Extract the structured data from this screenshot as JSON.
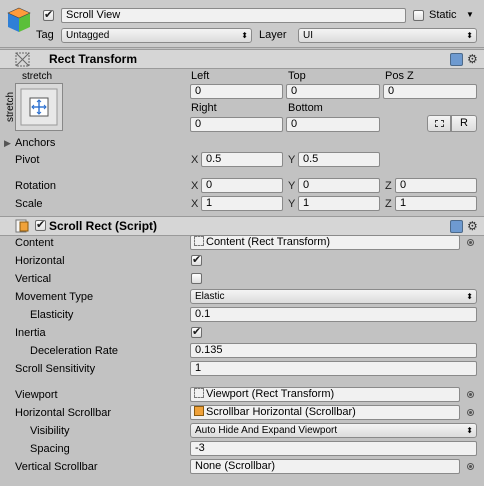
{
  "gameobject": {
    "name": "Scroll View",
    "static_label": "Static",
    "active": true,
    "static": false,
    "tag_label": "Tag",
    "tag_value": "Untagged",
    "layer_label": "Layer",
    "layer_value": "UI"
  },
  "rect_transform": {
    "title": "Rect Transform",
    "anchor_preset_top": "stretch",
    "anchor_preset_side": "stretch",
    "left_label": "Left",
    "top_label": "Top",
    "posz_label": "Pos Z",
    "left": "0",
    "top": "0",
    "posz": "0",
    "right_label": "Right",
    "bottom_label": "Bottom",
    "right": "0",
    "bottom": "0",
    "raw_button": "R",
    "anchors_label": "Anchors",
    "pivot_label": "Pivot",
    "pivot_x": "0.5",
    "pivot_y": "0.5",
    "rotation_label": "Rotation",
    "rot_x": "0",
    "rot_y": "0",
    "rot_z": "0",
    "scale_label": "Scale",
    "scale_x": "1",
    "scale_y": "1",
    "scale_z": "1",
    "x": "X",
    "y": "Y",
    "z": "Z"
  },
  "scroll_rect": {
    "title": "Scroll Rect (Script)",
    "enabled": true,
    "content_label": "Content",
    "content_value": "Content (Rect Transform)",
    "horizontal_label": "Horizontal",
    "horizontal": true,
    "vertical_label": "Vertical",
    "vertical": false,
    "movement_type_label": "Movement Type",
    "movement_type_value": "Elastic",
    "elasticity_label": "Elasticity",
    "elasticity_value": "0.1",
    "inertia_label": "Inertia",
    "inertia": true,
    "deceleration_label": "Deceleration Rate",
    "deceleration_value": "0.135",
    "sensitivity_label": "Scroll Sensitivity",
    "sensitivity_value": "1",
    "viewport_label": "Viewport",
    "viewport_value": "Viewport (Rect Transform)",
    "hscroll_label": "Horizontal Scrollbar",
    "hscroll_value": "Scrollbar Horizontal (Scrollbar)",
    "visibility_label": "Visibility",
    "visibility_value": "Auto Hide And Expand Viewport",
    "spacing_label": "Spacing",
    "spacing_value": "-3",
    "vscroll_label": "Vertical Scrollbar",
    "vscroll_value": "None (Scrollbar)"
  },
  "icons": [
    "gameobject-cube-icon",
    "help-icon",
    "gear-icon",
    "rect-transform-icon",
    "script-icon",
    "object-picker-icon",
    "anchor-preset-icon",
    "blueprint-icon"
  ]
}
